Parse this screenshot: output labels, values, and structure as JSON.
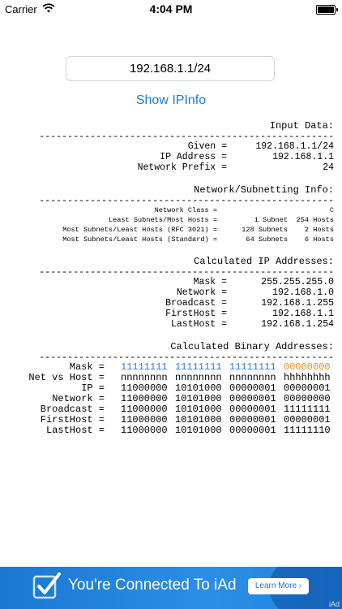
{
  "status_bar": {
    "carrier": "Carrier",
    "time": "4:04 PM",
    "battery_level": 1.0
  },
  "input": {
    "value": "192.168.1.1/24"
  },
  "show_button": {
    "label": "Show IPInfo"
  },
  "dashes": "------------------------------------------------------------",
  "input_data": {
    "title": "Input Data:",
    "rows": [
      {
        "key": "Given =",
        "value": "192.168.1.1/24"
      },
      {
        "key": "IP Address =",
        "value": "192.168.1.1"
      },
      {
        "key": "Network Prefix =",
        "value": "24"
      }
    ]
  },
  "subnet_info": {
    "title": "Network/Subnetting Info:",
    "rows": [
      {
        "key": "Network Class =",
        "c1": "",
        "c2": "C"
      },
      {
        "key": "Least Subnets/Most Hosts =",
        "c1": "1 Subnet",
        "c2": "254 Hosts"
      },
      {
        "key": "Most Subnets/Least Hosts (RFC 3021) =",
        "c1": "128 Subnets",
        "c2": "2 Hosts"
      },
      {
        "key": "Most Subnets/Least Hosts (Standard) =",
        "c1": "64 Subnets",
        "c2": "6 Hosts"
      }
    ]
  },
  "calc_ip": {
    "title": "Calculated IP Addresses:",
    "rows": [
      {
        "key": "Mask =",
        "value": "255.255.255.0"
      },
      {
        "key": "Network =",
        "value": "192.168.1.0"
      },
      {
        "key": "Broadcast =",
        "value": "192.168.1.255"
      },
      {
        "key": "FirstHost =",
        "value": "192.168.1.1"
      },
      {
        "key": "LastHost =",
        "value": "192.168.1.254"
      }
    ]
  },
  "calc_binary": {
    "title": "Calculated Binary Addresses:",
    "rows": [
      {
        "key": "Mask =",
        "octets": [
          "11111111",
          "11111111",
          "11111111",
          "00000000"
        ]
      },
      {
        "key": "Net vs Host =",
        "octets": [
          "nnnnnnnn",
          "nnnnnnnn",
          "nnnnnnnn",
          "hhhhhhhh"
        ]
      },
      {
        "key": "IP =",
        "octets": [
          "11000000",
          "10101000",
          "00000001",
          "00000001"
        ]
      },
      {
        "key": "Network =",
        "octets": [
          "11000000",
          "10101000",
          "00000001",
          "00000000"
        ]
      },
      {
        "key": "Broadcast =",
        "octets": [
          "11000000",
          "10101000",
          "00000001",
          "11111111"
        ]
      },
      {
        "key": "FirstHost =",
        "octets": [
          "11000000",
          "10101000",
          "00000001",
          "00000001"
        ]
      },
      {
        "key": "LastHost =",
        "octets": [
          "11000000",
          "10101000",
          "00000001",
          "11111110"
        ]
      }
    ]
  },
  "colors": {
    "network_bits": "#2f7bd6",
    "host_bits": "#e8901c",
    "link": "#1a7ed8"
  },
  "ad": {
    "text": "You're Connected To iAd",
    "button": "Learn More ›",
    "mark": "iAd"
  }
}
